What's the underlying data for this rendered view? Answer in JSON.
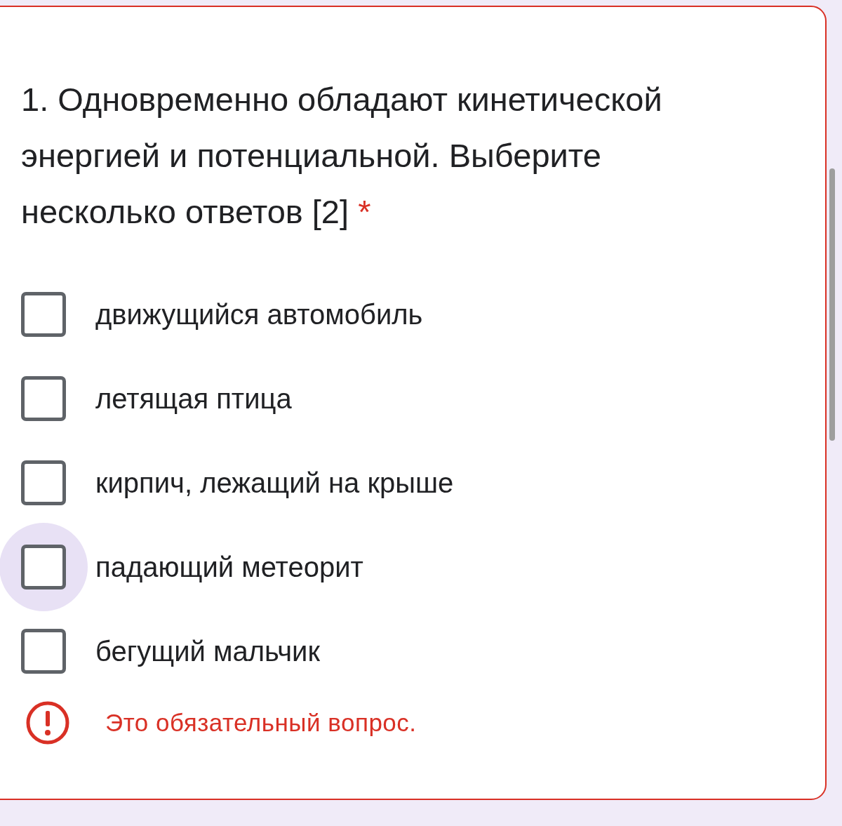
{
  "question": {
    "title": "1. Одновременно обладают кинетической энергией и потенциальной. Выберите несколько ответов [2]",
    "required_mark": "*"
  },
  "options": [
    {
      "label": "движущийся автомобиль",
      "checked": false,
      "focused": false
    },
    {
      "label": "летящая птица",
      "checked": false,
      "focused": false
    },
    {
      "label": "кирпич, лежащий на крыше",
      "checked": false,
      "focused": false
    },
    {
      "label": "падающий метеорит",
      "checked": false,
      "focused": true
    },
    {
      "label": "бегущий мальчик",
      "checked": false,
      "focused": false
    }
  ],
  "error": {
    "message": "Это обязательный вопрос."
  }
}
